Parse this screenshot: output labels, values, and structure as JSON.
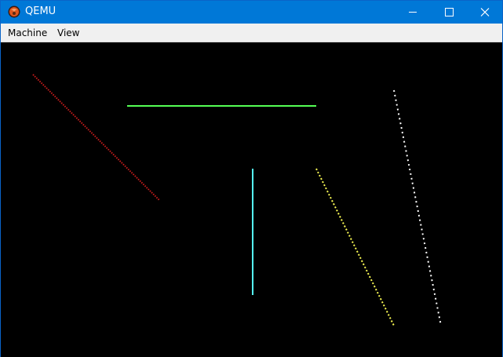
{
  "window": {
    "title": "QEMU",
    "title_bar_color": "#0078d7",
    "app_icon": "qemu-logo-icon",
    "controls": [
      "minimize-icon",
      "maximize-icon",
      "close-icon"
    ]
  },
  "menubar": {
    "items": [
      {
        "label": "Machine"
      },
      {
        "label": "View"
      }
    ]
  },
  "display": {
    "background": "#000000",
    "lines": [
      {
        "name": "red-dotted-diagonal-line",
        "color": "#cc1c1c",
        "style": "dotted"
      },
      {
        "name": "green-horizontal-line",
        "color": "#55ff55",
        "style": "solid"
      },
      {
        "name": "cyan-vertical-line",
        "color": "#55ffff",
        "style": "solid"
      },
      {
        "name": "yellow-dotted-diagonal-line",
        "color": "#ffff55",
        "style": "dotted"
      },
      {
        "name": "white-dotted-diagonal-line",
        "color": "#ffffff",
        "style": "dotted"
      }
    ]
  }
}
